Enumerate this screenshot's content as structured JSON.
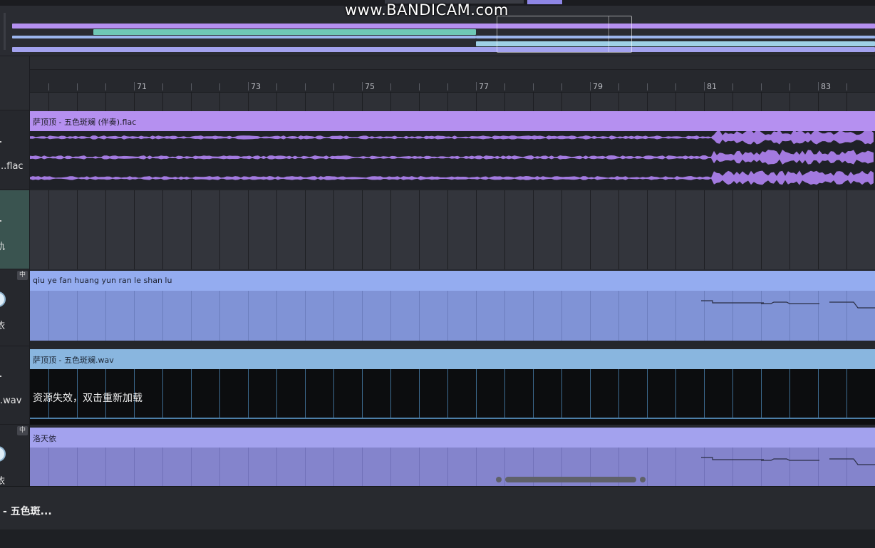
{
  "watermark": "www.BANDICAM.com",
  "ruler": {
    "labels": [
      "71",
      "73",
      "75",
      "77",
      "79",
      "81",
      "83"
    ]
  },
  "tracks": [
    {
      "left_label": "..flac",
      "clip_title": "萨顶顶 - 五色斑斓 (伴奏).flac",
      "type": "audio",
      "color": "#b590f0"
    },
    {
      "left_label": "轨",
      "clip_title": "",
      "type": "empty"
    },
    {
      "left_label": "依",
      "badge": "中",
      "clip_title": "qiu ye fan huang yun ran le shan lu",
      "type": "vocal",
      "color": "#94acf0"
    },
    {
      "left_label": ".wav",
      "clip_title": "萨顶顶 - 五色斑斓.wav",
      "missing_text": "资源失效，双击重新加载",
      "type": "missing-audio",
      "color": "#89b6df"
    },
    {
      "left_label": "依",
      "badge": "中",
      "clip_title": "洛天依",
      "type": "vocal",
      "color": "#a3a2ee"
    }
  ],
  "footer": {
    "title": "- 五色斑..."
  },
  "colors": {
    "background": "#25272d",
    "accent_purple": "#b590f0",
    "accent_blue": "#94acf0",
    "accent_teal": "#6fc8b6"
  }
}
